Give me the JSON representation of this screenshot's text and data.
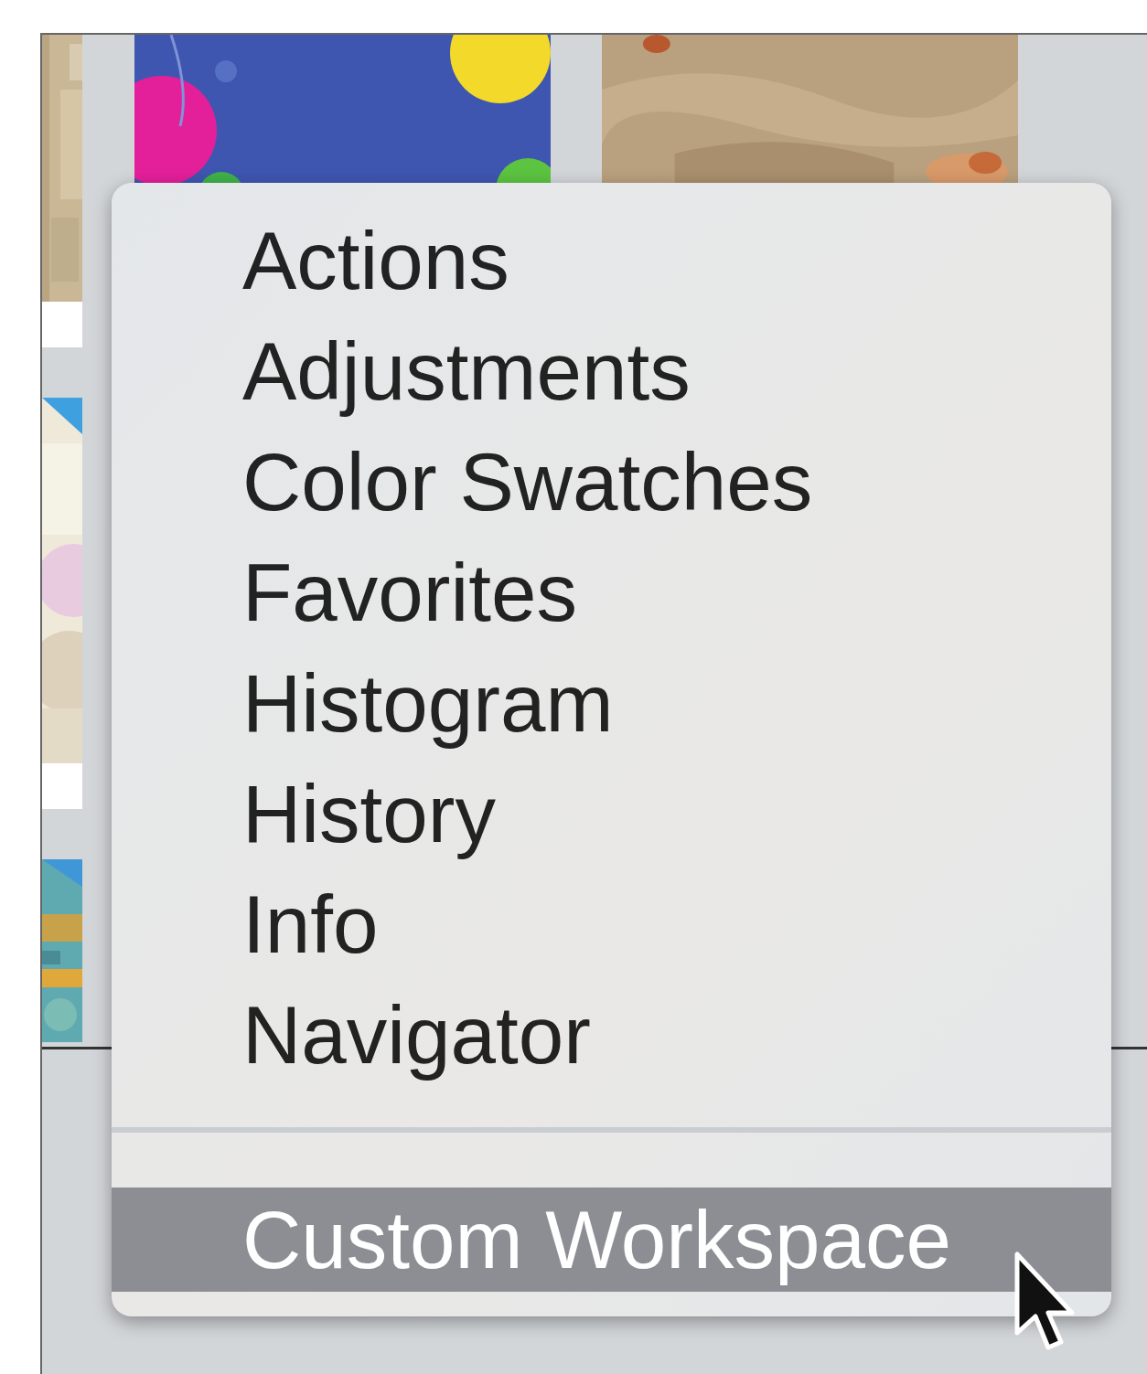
{
  "menu": {
    "sections": [
      {
        "items": [
          {
            "label": "Actions",
            "selected": false
          },
          {
            "label": "Adjustments",
            "selected": false
          },
          {
            "label": "Color Swatches",
            "selected": false
          },
          {
            "label": "Favorites",
            "selected": false
          },
          {
            "label": "Histogram",
            "selected": false
          },
          {
            "label": "History",
            "selected": false
          },
          {
            "label": "Info",
            "selected": false
          },
          {
            "label": "Navigator",
            "selected": false
          }
        ]
      },
      {
        "items": [
          {
            "label": "Custom Workspace",
            "selected": true
          }
        ]
      }
    ]
  }
}
